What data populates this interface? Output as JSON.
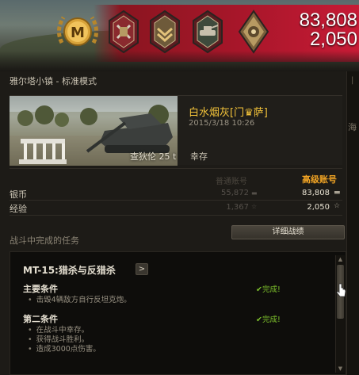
{
  "banner": {
    "credits_total": "83,808",
    "xp_total": "2,050",
    "mastery_letter": "M"
  },
  "battle": {
    "map_mode": "雅尔塔小镇 - 标准模式",
    "player_name": "白水烟灰[门♛萨]",
    "datetime": "2015/3/18 10:26",
    "tank_name": "查狄伦 25 t",
    "status": "幸存"
  },
  "accounts": {
    "basic_header": "普通账号",
    "premium_header": "高级账号",
    "rows": [
      {
        "label": "银币",
        "basic": "55,872",
        "premium": "83,808"
      },
      {
        "label": "经验",
        "basic": "1,367",
        "premium": "2,050"
      }
    ]
  },
  "quests": {
    "section_title": "战斗中完成的任务",
    "detail_button": "详细战绩",
    "quest_name": "MT-15:猎杀与反猎杀",
    "quest_arrow": ">",
    "primary": {
      "title": "主要条件",
      "status": "✔完成!",
      "items": [
        "击毁4辆敌方自行反坦克炮。"
      ]
    },
    "secondary": {
      "title": "第二条件",
      "status": "✔完成!",
      "items": [
        "在战斗中幸存。",
        "获得战斗胜利。",
        "造成3000点伤害。"
      ]
    }
  },
  "side": {
    "fold_char": "海"
  },
  "colors": {
    "gold": "#f2c23a",
    "premium": "#f0a324",
    "complete": "#7fc42c",
    "banner_red": "#c81b36"
  },
  "icons": [
    "mastery-badge-icon",
    "medal-icon",
    "credits-icon",
    "xp-star-icon",
    "mouse-cursor-icon"
  ]
}
